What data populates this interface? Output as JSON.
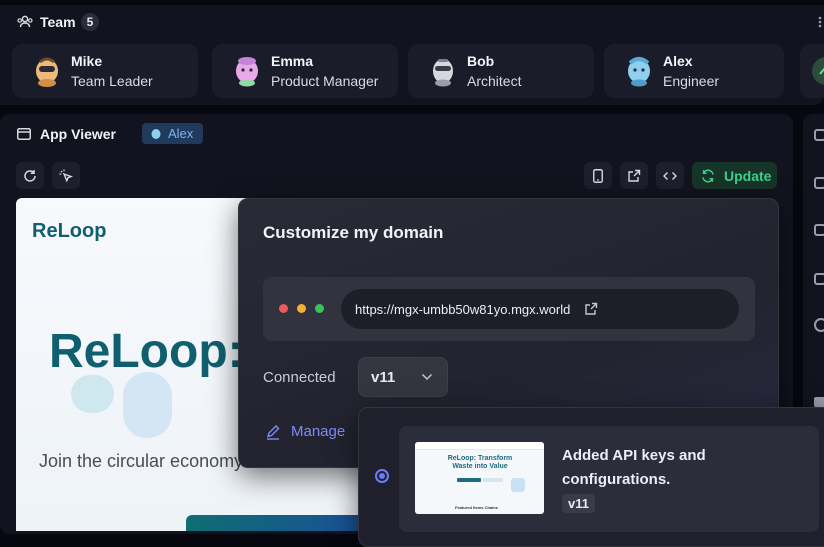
{
  "team": {
    "title": "Team",
    "count": "5"
  },
  "members": [
    {
      "name": "Mike",
      "role": "Team Leader",
      "color": "#f0b97a"
    },
    {
      "name": "Emma",
      "role": "Product Manager",
      "color": "#e9a9e9"
    },
    {
      "name": "Bob",
      "role": "Architect",
      "color": "#d7d8de"
    },
    {
      "name": "Alex",
      "role": "Engineer",
      "color": "#8fd0ee"
    }
  ],
  "app_viewer": {
    "title": "App Viewer",
    "agent": "Alex",
    "update_label": "Update"
  },
  "preview": {
    "logo": "ReLoop",
    "hero_title": "ReLoop:",
    "tagline": "Join the circular economy",
    "brand_color": "#0f5f6e"
  },
  "domain_popup": {
    "title": "Customize my domain",
    "url": "https://mgx-umbb50w81yo.mgx.world",
    "status_label": "Connected",
    "version": "v11",
    "manage_label": "Manage"
  },
  "version_list": {
    "items": [
      {
        "description": "Added API keys and configurations.",
        "version": "v11",
        "thumb_title": "ReLoop: Transform Waste into Value",
        "thumb_section": "Featured Items Chains"
      }
    ]
  },
  "colors": {
    "accent_green": "#3ecf8e",
    "accent_blue": "#6b7cf6",
    "badge_bg": "#1f3a5c"
  }
}
